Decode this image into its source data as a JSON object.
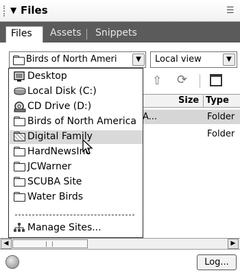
{
  "panel": {
    "title": "Files",
    "collapse_icon": "triangle-down-icon",
    "options_icon": "panel-options-icon"
  },
  "tabs": [
    {
      "label": "Files",
      "active": true
    },
    {
      "label": "Assets",
      "active": false
    },
    {
      "label": "Snippets",
      "active": false
    }
  ],
  "site_select": {
    "value": "Birds of North Ameri",
    "icon": "folder-icon"
  },
  "view_select": {
    "value": "Local view"
  },
  "toolbar": {
    "up_icon": "put-up-arrow-icon",
    "refresh_icon": "refresh-icon",
    "expand_icon": "expand-window-icon"
  },
  "columns": {
    "size": "Size",
    "type": "Type"
  },
  "rows": [
    {
      "name": "A...",
      "type": "Folder",
      "selected": true
    },
    {
      "name": "",
      "type": "Folder",
      "selected": false
    }
  ],
  "dropdown": {
    "items": [
      {
        "label": "Desktop",
        "icon": "desktop-icon"
      },
      {
        "label": "Local Disk (C:)",
        "icon": "hard-disk-icon"
      },
      {
        "label": "CD Drive (D:)",
        "icon": "cd-drive-icon"
      },
      {
        "label": "Birds of North America",
        "icon": "folder-icon"
      },
      {
        "label": "Digital Family",
        "icon": "folder-icon",
        "highlighted": true
      },
      {
        "label": "HardNewsInc",
        "icon": "folder-icon"
      },
      {
        "label": "JCWarner",
        "icon": "folder-icon"
      },
      {
        "label": "SCUBA Site",
        "icon": "folder-icon"
      },
      {
        "label": "Water Birds",
        "icon": "folder-icon"
      },
      {
        "label": "Manage Sites...",
        "icon": "site-hierarchy-icon"
      }
    ]
  },
  "status": {
    "log_label": "Log..."
  }
}
